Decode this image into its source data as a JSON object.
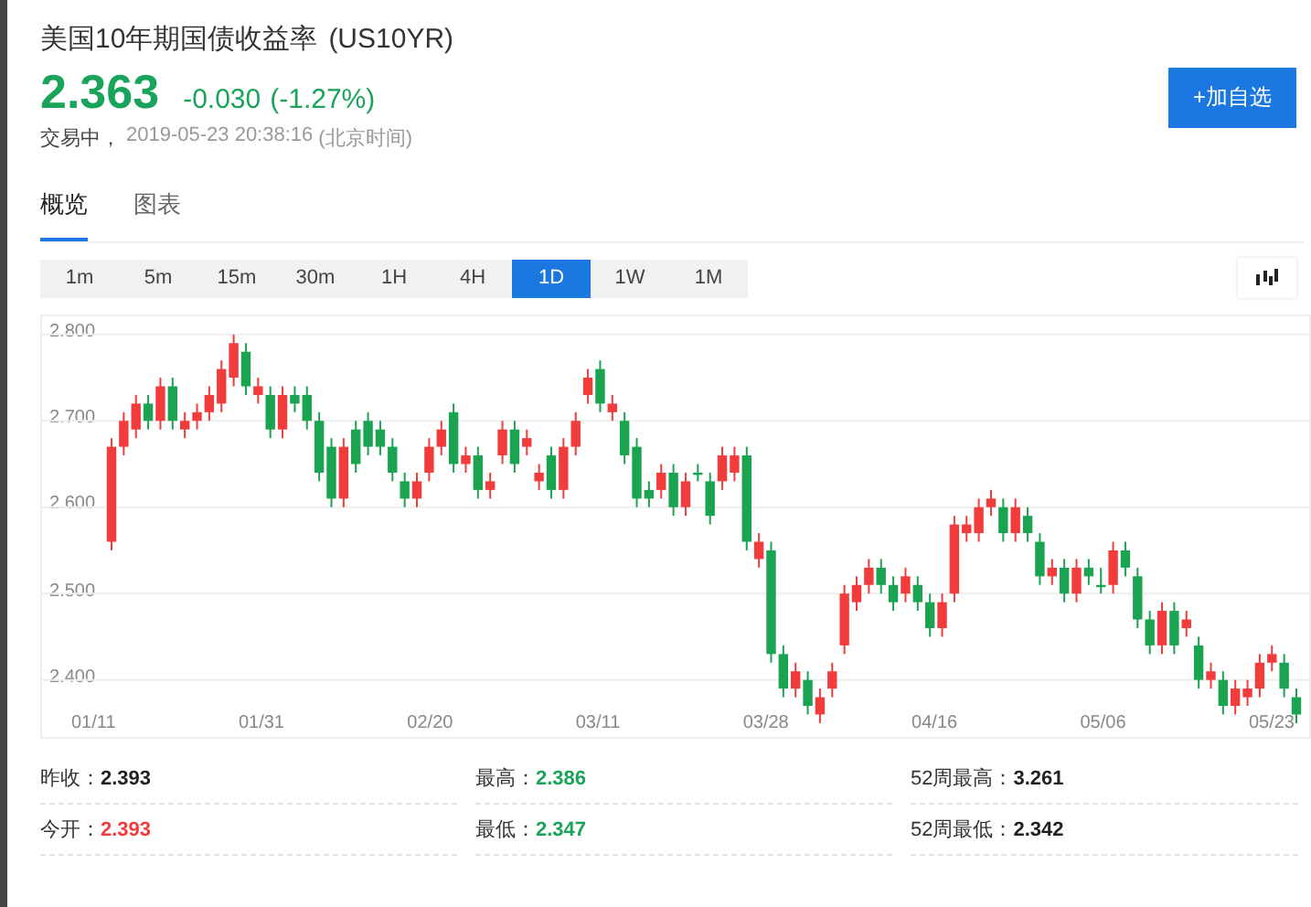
{
  "title": "美国10年期国债收益率",
  "symbol": "(US10YR)",
  "quote": {
    "price": "2.363",
    "change": "-0.030",
    "percent": "(-1.27%)",
    "color": "#1aa35a"
  },
  "status": {
    "state": "交易中，",
    "time": "2019-05-23 20:38:16",
    "zone": "(北京时间)"
  },
  "add_button": "+加自选",
  "tabs": [
    {
      "label": "概览",
      "selected": true
    },
    {
      "label": "图表",
      "selected": false
    }
  ],
  "periods": [
    {
      "label": "1m",
      "selected": false
    },
    {
      "label": "5m",
      "selected": false
    },
    {
      "label": "15m",
      "selected": false
    },
    {
      "label": "30m",
      "selected": false
    },
    {
      "label": "1H",
      "selected": false
    },
    {
      "label": "4H",
      "selected": false
    },
    {
      "label": "1D",
      "selected": true
    },
    {
      "label": "1W",
      "selected": false
    },
    {
      "label": "1M",
      "selected": false
    }
  ],
  "chart": {
    "x_labels": [
      "01/11",
      "01/31",
      "02/20",
      "03/11",
      "03/28",
      "04/16",
      "05/06",
      "05/23"
    ],
    "chart_data": {
      "type": "candlestick",
      "ylim": [
        2.334,
        2.821
      ],
      "grid": true,
      "yticks": [
        {
          "value": 2.8,
          "label": "2.800"
        },
        {
          "value": 2.7,
          "label": "2.700"
        },
        {
          "value": 2.6,
          "label": "2.600"
        },
        {
          "value": 2.5,
          "label": "2.500"
        },
        {
          "value": 2.4,
          "label": "2.400"
        }
      ],
      "ohlc": [
        [
          2.56,
          2.68,
          2.55,
          2.67
        ],
        [
          2.67,
          2.71,
          2.66,
          2.7
        ],
        [
          2.69,
          2.73,
          2.68,
          2.72
        ],
        [
          2.72,
          2.73,
          2.69,
          2.7
        ],
        [
          2.7,
          2.75,
          2.69,
          2.74
        ],
        [
          2.74,
          2.75,
          2.69,
          2.7
        ],
        [
          2.69,
          2.71,
          2.68,
          2.7
        ],
        [
          2.7,
          2.72,
          2.69,
          2.71
        ],
        [
          2.71,
          2.74,
          2.7,
          2.73
        ],
        [
          2.72,
          2.77,
          2.71,
          2.76
        ],
        [
          2.75,
          2.8,
          2.74,
          2.79
        ],
        [
          2.78,
          2.79,
          2.73,
          2.74
        ],
        [
          2.73,
          2.75,
          2.72,
          2.74
        ],
        [
          2.73,
          2.74,
          2.68,
          2.69
        ],
        [
          2.69,
          2.74,
          2.68,
          2.73
        ],
        [
          2.73,
          2.74,
          2.71,
          2.72
        ],
        [
          2.73,
          2.74,
          2.69,
          2.7
        ],
        [
          2.7,
          2.71,
          2.63,
          2.64
        ],
        [
          2.67,
          2.68,
          2.6,
          2.61
        ],
        [
          2.61,
          2.68,
          2.6,
          2.67
        ],
        [
          2.69,
          2.7,
          2.64,
          2.65
        ],
        [
          2.7,
          2.71,
          2.66,
          2.67
        ],
        [
          2.69,
          2.7,
          2.66,
          2.67
        ],
        [
          2.67,
          2.68,
          2.63,
          2.64
        ],
        [
          2.63,
          2.64,
          2.6,
          2.61
        ],
        [
          2.61,
          2.64,
          2.6,
          2.63
        ],
        [
          2.64,
          2.68,
          2.63,
          2.67
        ],
        [
          2.67,
          2.7,
          2.66,
          2.69
        ],
        [
          2.71,
          2.72,
          2.64,
          2.65
        ],
        [
          2.65,
          2.67,
          2.64,
          2.66
        ],
        [
          2.66,
          2.67,
          2.61,
          2.62
        ],
        [
          2.62,
          2.64,
          2.61,
          2.63
        ],
        [
          2.66,
          2.7,
          2.65,
          2.69
        ],
        [
          2.69,
          2.7,
          2.64,
          2.65
        ],
        [
          2.67,
          2.69,
          2.66,
          2.68
        ],
        [
          2.63,
          2.65,
          2.62,
          2.64
        ],
        [
          2.66,
          2.67,
          2.61,
          2.62
        ],
        [
          2.62,
          2.68,
          2.61,
          2.67
        ],
        [
          2.67,
          2.71,
          2.66,
          2.7
        ],
        [
          2.73,
          2.76,
          2.72,
          2.75
        ],
        [
          2.76,
          2.77,
          2.71,
          2.72
        ],
        [
          2.71,
          2.73,
          2.7,
          2.72
        ],
        [
          2.7,
          2.71,
          2.65,
          2.66
        ],
        [
          2.67,
          2.68,
          2.6,
          2.61
        ],
        [
          2.62,
          2.63,
          2.6,
          2.61
        ],
        [
          2.62,
          2.65,
          2.61,
          2.64
        ],
        [
          2.64,
          2.65,
          2.59,
          2.6
        ],
        [
          2.6,
          2.64,
          2.59,
          2.63
        ],
        [
          2.64,
          2.65,
          2.63,
          2.64
        ],
        [
          2.63,
          2.64,
          2.58,
          2.59
        ],
        [
          2.63,
          2.67,
          2.62,
          2.66
        ],
        [
          2.64,
          2.67,
          2.63,
          2.66
        ],
        [
          2.66,
          2.67,
          2.55,
          2.56
        ],
        [
          2.54,
          2.57,
          2.53,
          2.56
        ],
        [
          2.55,
          2.56,
          2.42,
          2.43
        ],
        [
          2.43,
          2.44,
          2.38,
          2.39
        ],
        [
          2.39,
          2.42,
          2.38,
          2.41
        ],
        [
          2.4,
          2.41,
          2.36,
          2.37
        ],
        [
          2.36,
          2.39,
          2.35,
          2.38
        ],
        [
          2.39,
          2.42,
          2.38,
          2.41
        ],
        [
          2.44,
          2.51,
          2.43,
          2.5
        ],
        [
          2.49,
          2.52,
          2.48,
          2.51
        ],
        [
          2.51,
          2.54,
          2.5,
          2.53
        ],
        [
          2.53,
          2.54,
          2.5,
          2.51
        ],
        [
          2.51,
          2.52,
          2.48,
          2.49
        ],
        [
          2.5,
          2.53,
          2.49,
          2.52
        ],
        [
          2.51,
          2.52,
          2.48,
          2.49
        ],
        [
          2.49,
          2.5,
          2.45,
          2.46
        ],
        [
          2.46,
          2.5,
          2.45,
          2.49
        ],
        [
          2.5,
          2.59,
          2.49,
          2.58
        ],
        [
          2.57,
          2.59,
          2.56,
          2.58
        ],
        [
          2.57,
          2.61,
          2.56,
          2.6
        ],
        [
          2.6,
          2.62,
          2.59,
          2.61
        ],
        [
          2.6,
          2.61,
          2.56,
          2.57
        ],
        [
          2.57,
          2.61,
          2.56,
          2.6
        ],
        [
          2.59,
          2.6,
          2.56,
          2.57
        ],
        [
          2.56,
          2.57,
          2.51,
          2.52
        ],
        [
          2.52,
          2.54,
          2.51,
          2.53
        ],
        [
          2.53,
          2.54,
          2.49,
          2.5
        ],
        [
          2.5,
          2.54,
          2.49,
          2.53
        ],
        [
          2.53,
          2.54,
          2.51,
          2.52
        ],
        [
          2.51,
          2.53,
          2.5,
          2.51
        ],
        [
          2.51,
          2.56,
          2.5,
          2.55
        ],
        [
          2.55,
          2.56,
          2.52,
          2.53
        ],
        [
          2.52,
          2.53,
          2.46,
          2.47
        ],
        [
          2.47,
          2.48,
          2.43,
          2.44
        ],
        [
          2.44,
          2.49,
          2.43,
          2.48
        ],
        [
          2.48,
          2.49,
          2.43,
          2.44
        ],
        [
          2.46,
          2.48,
          2.45,
          2.47
        ],
        [
          2.44,
          2.45,
          2.39,
          2.4
        ],
        [
          2.4,
          2.42,
          2.39,
          2.41
        ],
        [
          2.4,
          2.41,
          2.36,
          2.37
        ],
        [
          2.37,
          2.4,
          2.36,
          2.39
        ],
        [
          2.38,
          2.4,
          2.37,
          2.39
        ],
        [
          2.39,
          2.43,
          2.38,
          2.42
        ],
        [
          2.42,
          2.44,
          2.41,
          2.43
        ],
        [
          2.42,
          2.43,
          2.38,
          2.39
        ],
        [
          2.38,
          2.39,
          2.35,
          2.36
        ]
      ]
    }
  },
  "stats": [
    {
      "label": "昨收：",
      "value": "2.393",
      "color": "#222222"
    },
    {
      "label": "最高：",
      "value": "2.386",
      "color": "#1aa35a"
    },
    {
      "label": "52周最高：",
      "value": "3.261",
      "color": "#222222"
    },
    {
      "label": "今开：",
      "value": "2.393",
      "color": "#f23c3c"
    },
    {
      "label": "最低：",
      "value": "2.347",
      "color": "#1aa35a"
    },
    {
      "label": "52周最低：",
      "value": "2.342",
      "color": "#222222"
    }
  ]
}
